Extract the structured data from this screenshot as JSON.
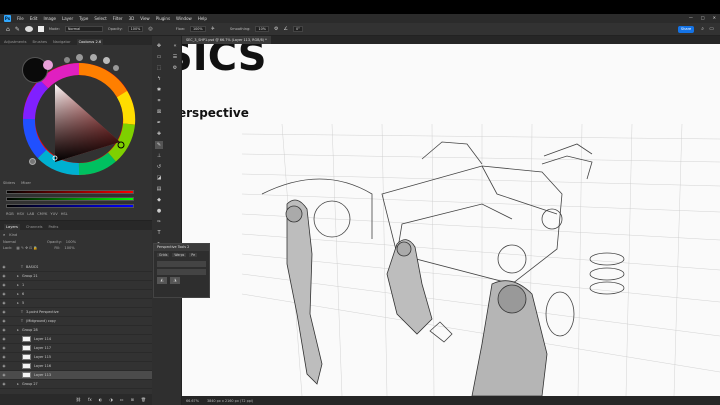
{
  "menu": {
    "logo": "Ps",
    "items": [
      "File",
      "Edit",
      "Image",
      "Layer",
      "Type",
      "Select",
      "Filter",
      "3D",
      "View",
      "Plugins",
      "Window",
      "Help"
    ],
    "window_controls": [
      "—",
      "□",
      "✕"
    ]
  },
  "options": {
    "mode_label": "Mode:",
    "mode_value": "Normal",
    "opacity_label": "Opacity:",
    "opacity_value": "100%",
    "flow_label": "Flow:",
    "flow_value": "100%",
    "smoothing_label": "Smoothing:",
    "smoothing_value": "10%",
    "angle_value": "0°",
    "share_label": "Share"
  },
  "left_panel": {
    "tabs": [
      "Adjustments",
      "Brushes",
      "Navigator",
      "Coolorus 2.6"
    ],
    "active_tab": "Coolorus 2.6",
    "sliders_tabs": [
      "Sliders",
      "Mixer"
    ],
    "slider_modes": [
      "RGB",
      "HSV",
      "LAB",
      "CMYK",
      "YUV",
      "HSL"
    ],
    "layers_tabs": [
      "Layers",
      "Channels",
      "Paths"
    ],
    "search_kind": "Kind",
    "blend_mode": "Normal",
    "opacity_label": "Opacity:",
    "opacity_value": "100%",
    "lock_label": "Lock:",
    "fill_label": "Fill:",
    "fill_value": "100%"
  },
  "layers": [
    {
      "name": "BASICS",
      "type": "text"
    },
    {
      "name": "Group 21",
      "type": "group"
    },
    {
      "name": "1",
      "type": "group"
    },
    {
      "name": "6",
      "type": "group"
    },
    {
      "name": "5",
      "type": "group"
    },
    {
      "name": "3-point Perspective",
      "type": "text"
    },
    {
      "name": "(Midground) copy",
      "type": "text"
    },
    {
      "name": "Group 28",
      "type": "group"
    },
    {
      "name": "Layer 114",
      "type": "layer"
    },
    {
      "name": "Layer 117",
      "type": "layer"
    },
    {
      "name": "Layer 115",
      "type": "layer"
    },
    {
      "name": "Layer 116",
      "type": "layer"
    },
    {
      "name": "Layer 113",
      "type": "layer",
      "selected": true
    },
    {
      "name": "Group 27",
      "type": "group"
    }
  ],
  "document": {
    "tab_title": "SEC_3_SHP1.psd @ 66.7% (Layer 113, RGB/8) *",
    "heading": "SICS",
    "subheading": "erspective"
  },
  "status": {
    "zoom": "66.67%",
    "dimensions": "3840 px x 2160 px (72 ppi)"
  },
  "perspective_panel": {
    "title": "Perspective Tools 2",
    "tabs": [
      "Grids",
      "Warps",
      "Pe"
    ]
  },
  "colors": {
    "foreground": "#0a0a0a",
    "background": "#e8a0d8",
    "accent": "#1473e6"
  }
}
